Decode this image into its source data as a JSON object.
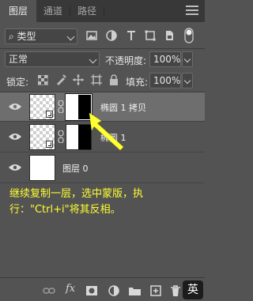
{
  "tabs": [
    {
      "label": "图层",
      "active": true
    },
    {
      "label": "通道",
      "active": false
    },
    {
      "label": "路径",
      "active": false
    }
  ],
  "filter": {
    "kind_label": "⌕ 类型",
    "icons": [
      "image-filter-icon",
      "adjustment-filter-icon",
      "type-filter-icon",
      "shape-filter-icon",
      "smart-object-filter-icon",
      "filter-toggle-icon"
    ]
  },
  "blend": {
    "mode": "正常",
    "opacity_label": "不透明度:",
    "opacity_value": "100%"
  },
  "lock": {
    "label": "锁定:",
    "fill_label": "填充:",
    "fill_value": "100%"
  },
  "layers": [
    {
      "name": "椭圆 1 拷贝",
      "selected": true,
      "visible": true,
      "has_mask": true
    },
    {
      "name": "椭圆 1",
      "selected": false,
      "visible": true,
      "has_mask": true
    },
    {
      "name": "图层 0",
      "selected": false,
      "visible": true,
      "has_mask": false
    }
  ],
  "annotation": {
    "text": "继续复制一层，选中蒙版，执行：\"Ctrl+i\"将其反相。",
    "color": "#ffff33"
  },
  "footer": {
    "icons": [
      "link-layers-icon",
      "fx-icon",
      "add-mask-icon",
      "adjustment-layer-icon",
      "new-group-icon",
      "new-layer-icon",
      "delete-icon"
    ],
    "fx_label": "fx"
  },
  "ime_badge": "英",
  "colors": {
    "panel": "#535353",
    "selected": "#6e6e6e",
    "arrow": "#ffff33"
  }
}
